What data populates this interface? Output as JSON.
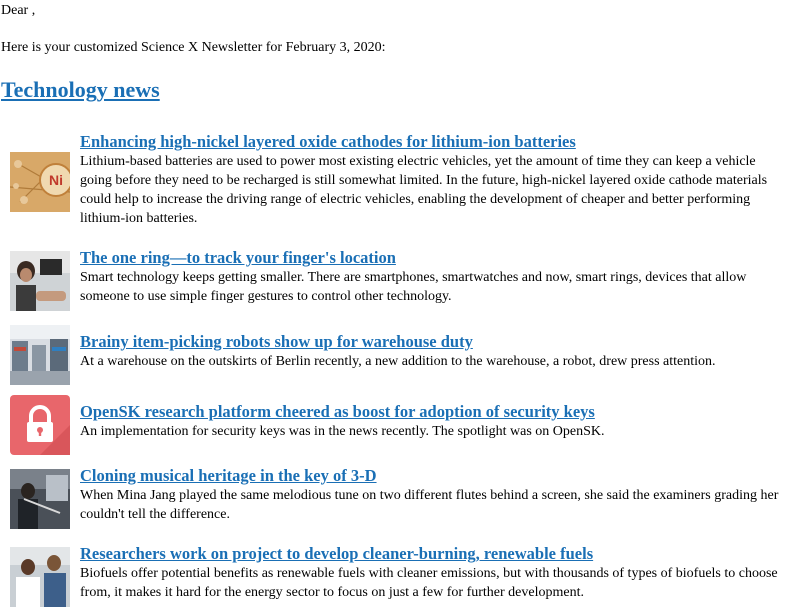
{
  "greeting": "Dear ,",
  "intro": "Here is your customized Science X Newsletter for February 3, 2020:",
  "section_title": "Technology news",
  "articles": [
    {
      "title": "Enhancing high-nickel layered oxide cathodes for lithium-ion batteries",
      "summary": "Lithium-based batteries are used to power most existing electric vehicles, yet the amount of time they can keep a vehicle going before they need to be recharged is still somewhat limited. In the future, high-nickel layered oxide cathode materials could help to increase the driving range of electric vehicles, enabling the development of cheaper and better performing lithium-ion batteries.",
      "thumb_text": "Ni"
    },
    {
      "title": "The one ring—to track your finger's location",
      "summary": "Smart technology keeps getting smaller. There are smartphones, smartwatches and now, smart rings, devices that allow someone to use simple finger gestures to control other technology."
    },
    {
      "title": "Brainy item-picking robots show up for warehouse duty",
      "summary": "At a warehouse on the outskirts of Berlin recently, a new addition to the warehouse, a robot, drew press attention."
    },
    {
      "title": "OpenSK research platform cheered as boost for adoption of security keys",
      "summary": "An implementation for security keys was in the news recently. The spotlight was on OpenSK."
    },
    {
      "title": "Cloning musical heritage in the key of 3-D",
      "summary": "When Mina Jang played the same melodious tune on two different flutes behind a screen, she said the examiners grading her couldn't tell the difference."
    },
    {
      "title": "Researchers work on project to develop cleaner-burning, renewable fuels",
      "summary": "Biofuels offer potential benefits as renewable fuels with cleaner emissions, but with thousands of types of biofuels to choose from, it makes it hard for the energy sector to focus on just a few for further development."
    }
  ],
  "colors": {
    "link": "#1a6fb5",
    "lock_bg": "#e8666b"
  }
}
